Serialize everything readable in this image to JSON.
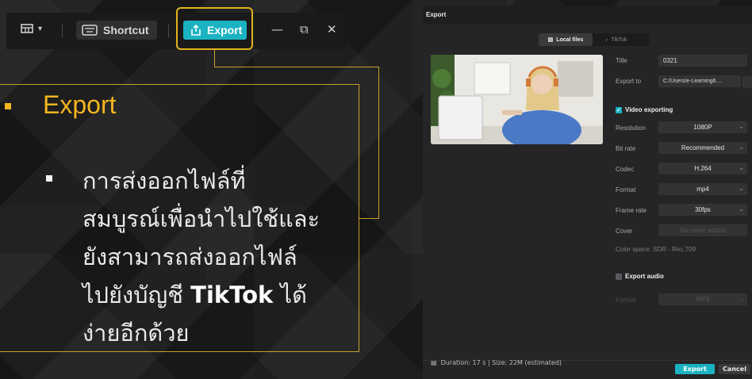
{
  "toolbar": {
    "shortcut_label": "Shortcut",
    "export_label": "Export",
    "layout_icon": "layout-grid-icon",
    "keyboard_icon": "keyboard-icon",
    "export_icon": "upload-share-icon"
  },
  "window_controls": {
    "minimize": "—",
    "restore": "⧉",
    "close": "✕"
  },
  "slide": {
    "heading": "Export",
    "body_lines": [
      "การส่งออกไฟล์ที่",
      "สมบูรณ์เพื่อนำไปใช้และ",
      "ยังสามารถส่งออกไฟล์",
      "ไปยังบัญชี ",
      "ง่ายอีกด้วย"
    ],
    "body_bold": "TikTok",
    "body_after_bold": " ได้",
    "accent_color": "#f3b520"
  },
  "dialog": {
    "title": "Export",
    "tabs": {
      "local": "Local files",
      "tiktok": "TikTok"
    },
    "fields": {
      "title_label": "Title",
      "title_value": "0321",
      "export_to_label": "Export to",
      "export_to_value": "C:/Users/e-Learning6...."
    },
    "video_section": "Video exporting",
    "video": {
      "resolution_label": "Resolution",
      "resolution_value": "1080P",
      "bitrate_label": "Bit rate",
      "bitrate_value": "Recommended",
      "codec_label": "Codec",
      "codec_value": "H.264",
      "format_label": "Format",
      "format_value": "mp4",
      "framerate_label": "Frame rate",
      "framerate_value": "30fps",
      "cover_label": "Cover",
      "cover_value": "No cover added",
      "color_space": "Color space: SDR - Rec.709"
    },
    "audio_section": "Export audio",
    "audio": {
      "format_label": "Format",
      "format_value": "MP3"
    },
    "footer_info": "Duration: 17 s | Size: 22M (estimated)",
    "export_button": "Export",
    "cancel_button": "Cancel",
    "accent_color": "#1bb3c2"
  }
}
